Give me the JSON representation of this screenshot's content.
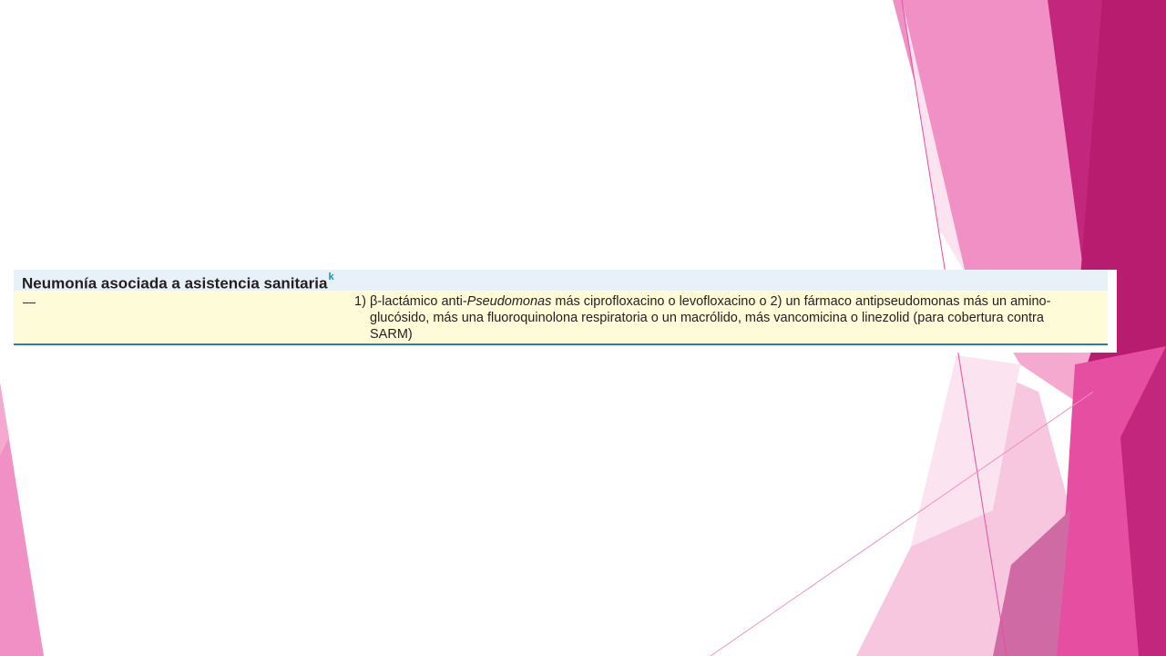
{
  "background": {
    "colors": {
      "light_pink": "#f7c6df",
      "pink": "#f090c4",
      "hot_pink": "#e64ea2",
      "magenta": "#c2267d",
      "deep_magenta": "#b81c6e",
      "header_fill": "#e8f0f8",
      "row_fill": "#fdfbd8",
      "rule_color": "#2a7fa8"
    }
  },
  "table": {
    "title": "Neumonía asociada a asistencia sanitaria",
    "title_superscript": "k",
    "row": {
      "left_cell": "—",
      "item_number": "1)",
      "line1_pre": "β-lactámico anti-",
      "line1_italic": "Pseudomonas",
      "line1_post": " más ciprofloxacino o levofloxacino o 2) un fármaco antipseudomonas más un amino-",
      "line2": "glucósido, más una fluoroquinolona respiratoria o un macrólido, más vancomicina o linezolid (para cobertura contra",
      "line3": "SARM)"
    }
  }
}
